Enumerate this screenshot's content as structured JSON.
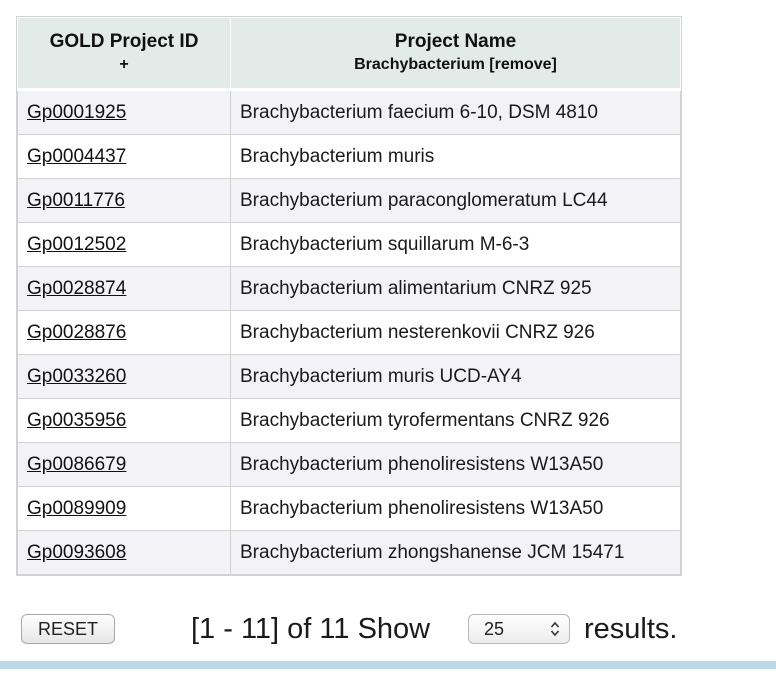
{
  "table": {
    "header_id": "GOLD Project ID",
    "header_id_sort": "+",
    "header_name": "Project Name",
    "header_name_filter": "Brachybacterium [remove]",
    "rows": [
      {
        "id": "Gp0001925",
        "name": "Brachybacterium faecium 6-10, DSM 4810"
      },
      {
        "id": "Gp0004437",
        "name": "Brachybacterium muris"
      },
      {
        "id": "Gp0011776",
        "name": "Brachybacterium paraconglomeratum LC44"
      },
      {
        "id": "Gp0012502",
        "name": "Brachybacterium squillarum M-6-3"
      },
      {
        "id": "Gp0028874",
        "name": "Brachybacterium alimentarium CNRZ 925"
      },
      {
        "id": "Gp0028876",
        "name": "Brachybacterium nesterenkovii CNRZ 926"
      },
      {
        "id": "Gp0033260",
        "name": "Brachybacterium muris UCD-AY4"
      },
      {
        "id": "Gp0035956",
        "name": "Brachybacterium tyrofermentans CNRZ 926"
      },
      {
        "id": "Gp0086679",
        "name": "Brachybacterium phenoliresistens W13A50"
      },
      {
        "id": "Gp0089909",
        "name": "Brachybacterium phenoliresistens W13A50"
      },
      {
        "id": "Gp0093608",
        "name": "Brachybacterium zhongshanense JCM 15471"
      }
    ]
  },
  "controls": {
    "reset_label": "RESET",
    "range_text": "[1 - 11] of 11 Show",
    "page_size_selected": "25",
    "results_text": "results."
  },
  "icons": {
    "select_arrows": "up-down-chevron-icon"
  },
  "colors": {
    "header_bg": "#e2ebe7",
    "row_alt_bg": "#f3f3f7",
    "bottom_bar": "#bcd8e5"
  }
}
